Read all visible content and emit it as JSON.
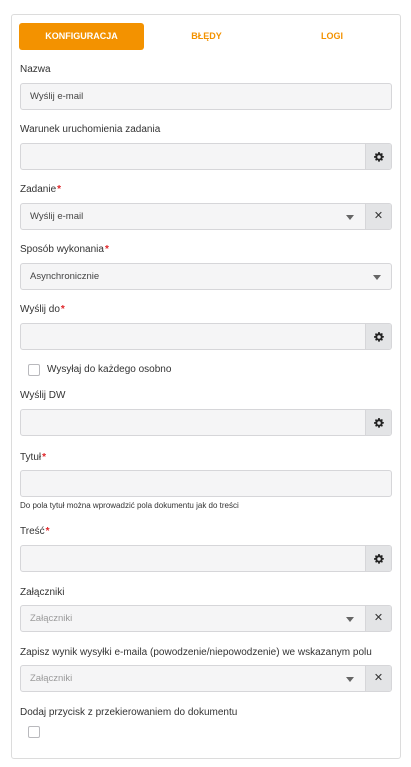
{
  "tabs": [
    {
      "label": "KONFIGURACJA",
      "active": true
    },
    {
      "label": "BŁĘDY",
      "active": false
    },
    {
      "label": "LOGI",
      "active": false
    }
  ],
  "fields": {
    "nazwa": {
      "label": "Nazwa",
      "value": "Wyślij e-mail"
    },
    "warunek": {
      "label": "Warunek uruchomienia zadania",
      "value": ""
    },
    "zadanie": {
      "label": "Zadanie",
      "required": true,
      "value": "Wyślij e-mail"
    },
    "sposob": {
      "label": "Sposób wykonania",
      "required": true,
      "value": "Asynchronicznie"
    },
    "wyslij_do": {
      "label": "Wyślij do",
      "required": true,
      "value": ""
    },
    "wysylaj_osobno": {
      "label": "Wysyłaj do każdego osobno",
      "checked": false
    },
    "wyslij_dw": {
      "label": "Wyślij DW",
      "value": ""
    },
    "tytul": {
      "label": "Tytuł",
      "required": true,
      "value": "",
      "hint": "Do pola tytuł można wprowadzić pola dokumentu jak do treści"
    },
    "tresc": {
      "label": "Treść",
      "required": true,
      "value": ""
    },
    "zalaczniki": {
      "label": "Załączniki",
      "placeholder": "Załączniki"
    },
    "zapisz_wynik": {
      "label": "Zapisz wynik wysyłki e-maila (powodzenie/niepowodzenie) we wskazanym polu",
      "placeholder": "Załączniki"
    },
    "dodaj_przycisk": {
      "label": "Dodaj przycisk z przekierowaniem do dokumentu",
      "checked": false
    }
  },
  "required_mark": "*",
  "colors": {
    "accent": "#f39200",
    "required": "#e0262a",
    "field_bg": "#f5f5f6"
  },
  "icons": {
    "gear": "gear-icon",
    "caret": "caret-down-icon",
    "clear": "close-icon"
  }
}
